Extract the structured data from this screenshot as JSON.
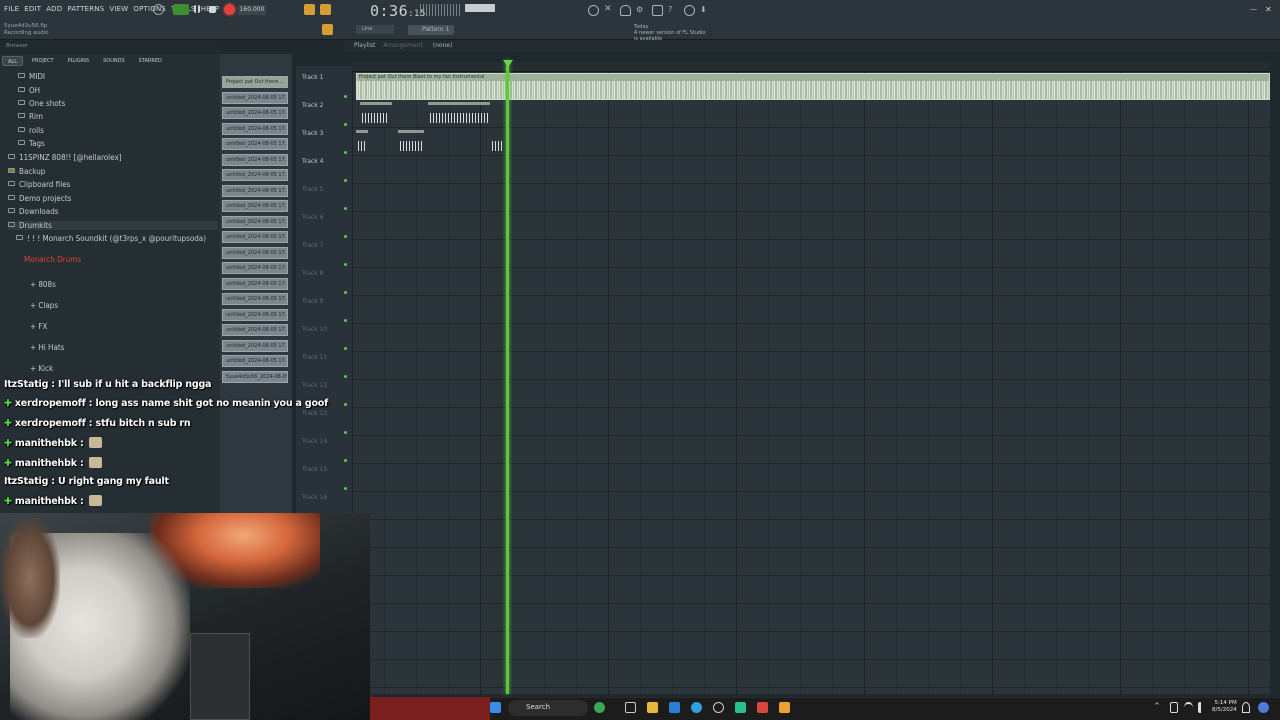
{
  "menu": [
    "FILE",
    "EDIT",
    "ADD",
    "PATTERNS",
    "VIEW",
    "OPTIONS",
    "TOOLS",
    "HELP"
  ],
  "project": {
    "file": "5yue4d3u56.flp",
    "status": "Recording audio"
  },
  "transport": {
    "tempo": "160.000",
    "time_main": "0:36",
    "time_small": ":15",
    "pattern": "Pattern 1",
    "snap": "Line"
  },
  "news": {
    "day": "Today",
    "text": "A newer version of FL Studio is available"
  },
  "browser": {
    "header": "Browser",
    "tabs": [
      "ALL",
      "PROJECT",
      "PLUGINS",
      "SOUNDS",
      "STARRED"
    ],
    "items": [
      "MIDI",
      "OH",
      "One shots",
      "Rim",
      "rolls",
      "Tags",
      "11SPINZ 808!! [@hellarolex]",
      "Backup",
      "Clipboard files",
      "Demo projects",
      "Downloads",
      "Drumkits",
      "! ! ! Monarch Soundkit (@t3rps_x @pouritupsoda)",
      "Monarch Drums",
      "808s",
      "Claps",
      "FX",
      "Hi Hats",
      "Kick"
    ]
  },
  "clips": [
    "Project pat Out there...",
    "untitled_2024-08-05 17...",
    "untitled_2024-08-05 17...",
    "untitled_2024-08-05 17...",
    "untitled_2024-08-05 17...",
    "untitled_2024-08-05 17...",
    "untitled_2024-08-05 17...",
    "untitled_2024-08-05 17...",
    "untitled_2024-08-05 17...",
    "untitled_2024-08-05 17...",
    "untitled_2024-08-05 17...",
    "untitled_2024-08-05 17...",
    "untitled_2024-08-05 17...",
    "untitled_2024-08-05 17...",
    "untitled_2024-08-05 17...",
    "untitled_2024-08-05 17...",
    "untitled_2024-08-05 17...",
    "untitled_2024-08-05 17...",
    "untitled_2024-08-05 17...",
    "5yue4d3u56_2024-08-05..."
  ],
  "playlist": {
    "title": "Playlist",
    "sub": "Arrangement",
    "pattern": "(none)",
    "main_clip": "Project pat Out there Blast to my fan Instrumental",
    "tracks": [
      "Track 1",
      "Track 2",
      "Track 3",
      "Track 4",
      "Track 5",
      "Track 6",
      "Track 7",
      "Track 8",
      "Track 9",
      "Track 10",
      "Track 11",
      "Track 12",
      "Track 13",
      "Track 14",
      "Track 15",
      "Track 16"
    ]
  },
  "chat": [
    {
      "user": "ItzStatig",
      "text": "I'll sub if u hit a backflip ngga",
      "badge": false
    },
    {
      "user": "xerdropemoff",
      "text": "long ass name shit got no meanin you a goof",
      "badge": true
    },
    {
      "user": "xerdropemoff",
      "text": "stfu bitch n sub rn",
      "badge": true
    },
    {
      "user": "manithehbk",
      "text": "",
      "badge": true,
      "emote": true
    },
    {
      "user": "manithehbk",
      "text": "",
      "badge": true,
      "emote": true
    },
    {
      "user": "ItzStatig",
      "text": "U right gang my fault",
      "badge": false
    },
    {
      "user": "manithehbk",
      "text": "",
      "badge": true,
      "emote": true
    }
  ],
  "taskbar": {
    "search": "Search",
    "time": "5:14 PM",
    "date": "8/5/2024"
  },
  "colors": {
    "accent_green": "#5ec93f",
    "record_red": "#e0413a",
    "chat_badge": "#57d84a"
  }
}
